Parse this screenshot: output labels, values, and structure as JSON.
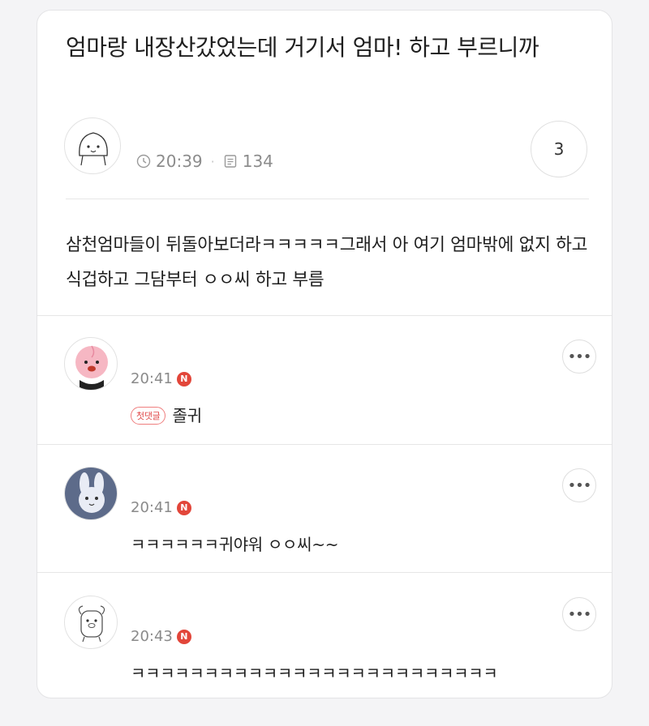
{
  "post": {
    "title": "엄마랑 내장산갔었는데 거기서 엄마! 하고 부르니까",
    "time": "20:39",
    "views": "134",
    "comment_count": "3",
    "body": "삼천엄마들이 뒤돌아보더라ㅋㅋㅋㅋㅋ그래서 아 여기 엄마밖에 없지 하고 식겁하고 그담부터 ㅇㅇ씨 하고 부름"
  },
  "comments": [
    {
      "time": "20:41",
      "new_badge": "N",
      "first_badge": "첫댓글",
      "text": "졸귀",
      "avatar": "peach-character"
    },
    {
      "time": "20:41",
      "new_badge": "N",
      "text": "ㅋㅋㅋㅋㅋㅋ귀야워 ㅇㅇ씨~~",
      "avatar": "rabbit-character"
    },
    {
      "time": "20:43",
      "new_badge": "N",
      "text": "ㅋㅋㅋㅋㅋㅋㅋㅋㅋㅋㅋㅋㅋㅋㅋㅋㅋㅋㅋㅋㅋㅋㅋㅋㅋ",
      "avatar": "piglet-character"
    }
  ],
  "icons": {
    "time": "clock-icon",
    "views": "document-icon",
    "more": "more-dots-icon"
  },
  "colors": {
    "new_badge": "#e2463a",
    "first_badge_border": "#ef7e7e"
  }
}
